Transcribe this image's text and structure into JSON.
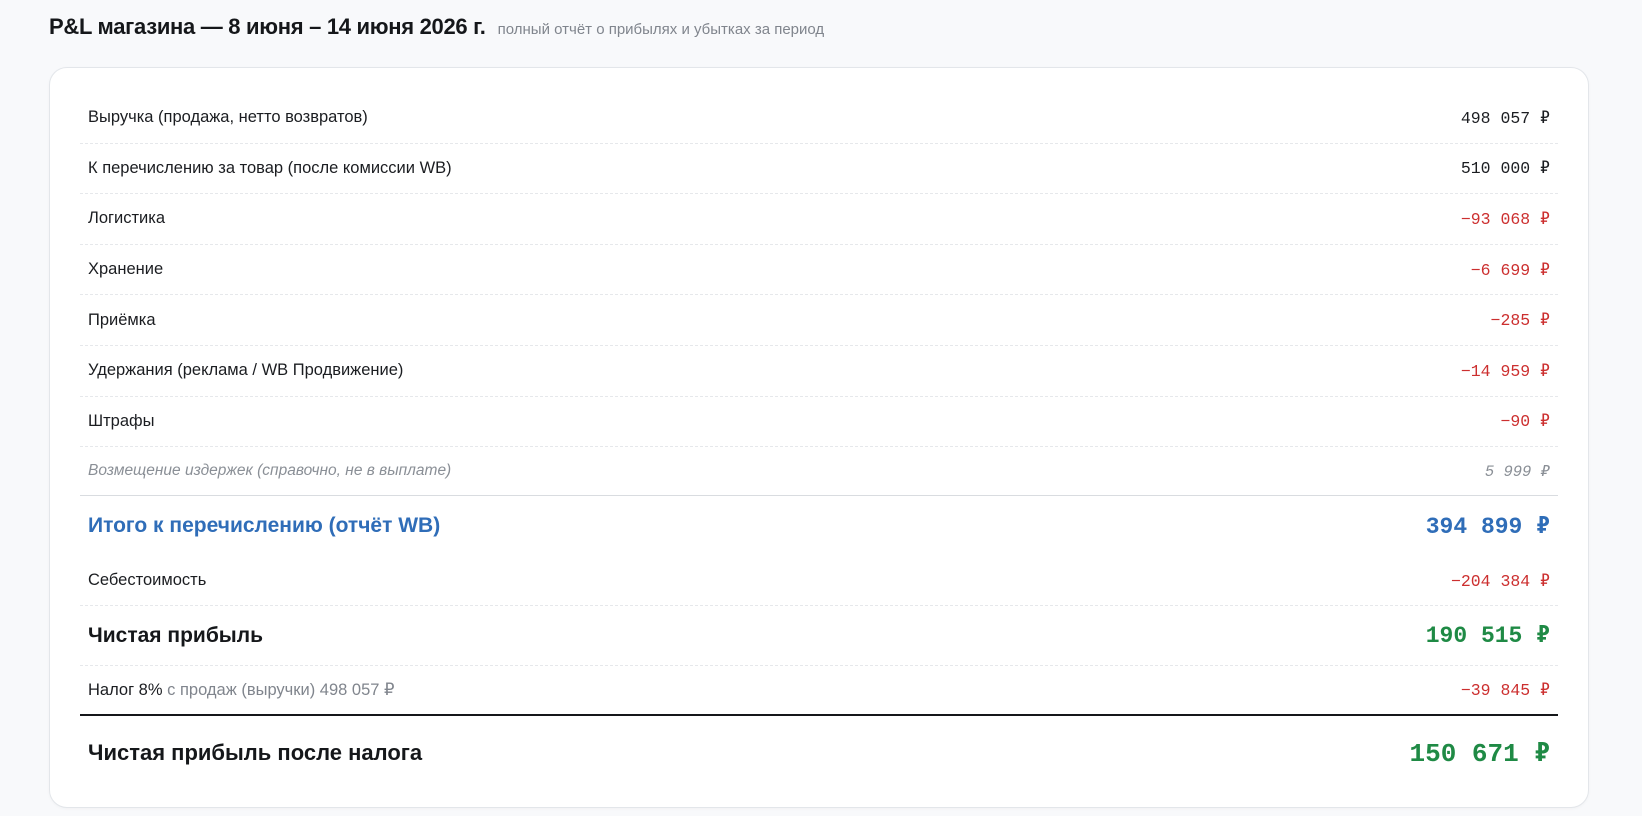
{
  "header": {
    "title": "P&L магазина — 8 июня – 14 июня 2026 г.",
    "subtitle": "полный отчёт о прибылях и убытках за период"
  },
  "report": {
    "rows": [
      {
        "label": "Выручка (продажа, нетто возвратов)",
        "value": "498 057 ₽"
      },
      {
        "label": "К перечислению за товар (после комиссии WB)",
        "value": "510 000 ₽"
      },
      {
        "label": "Логистика",
        "value": "−93 068 ₽"
      },
      {
        "label": "Хранение",
        "value": "−6 699 ₽"
      },
      {
        "label": "Приёмка",
        "value": "−285 ₽"
      },
      {
        "label": "Удержания (реклама / WB Продвижение)",
        "value": "−14 959 ₽"
      },
      {
        "label": "Штрафы",
        "value": "−90 ₽"
      }
    ],
    "compensation": {
      "label": "Возмещение издержек (справочно, не в выплате)",
      "value": "5 999 ₽"
    },
    "total_wb": {
      "label": "Итого к перечислению (отчёт WB)",
      "value": "394 899 ₽"
    },
    "cost": {
      "label": "Себестоимость",
      "value": "−204 384 ₽"
    },
    "net_profit": {
      "label": "Чистая прибыль",
      "value": "190 515 ₽"
    },
    "tax": {
      "label": "Налог 8%",
      "note": "с продаж (выручки) 498 057 ₽",
      "value": "−39 845 ₽"
    },
    "net_after_tax": {
      "label": "Чистая прибыль после налога",
      "value": "150 671 ₽"
    }
  },
  "colors": {
    "negative": "#cc2f2f",
    "total_blue": "#2f6db8",
    "profit_green": "#1f8a45"
  }
}
